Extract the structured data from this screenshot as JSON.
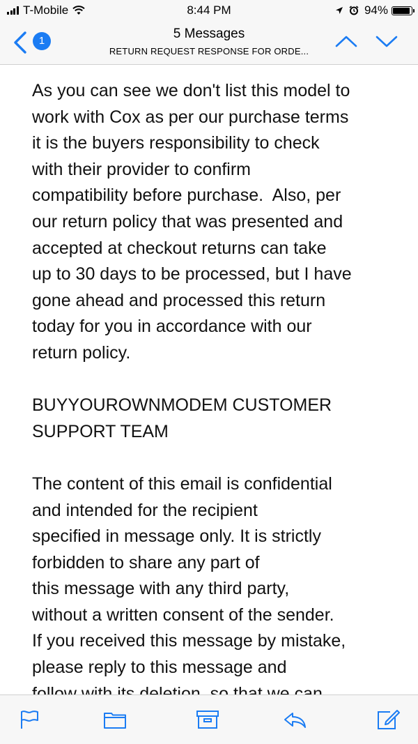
{
  "status_bar": {
    "carrier": "T-Mobile",
    "time": "8:44 PM",
    "battery": "94%",
    "battery_level": 0.94
  },
  "nav": {
    "back_badge_count": "1",
    "title": "5 Messages",
    "subtitle": "RETURN REQUEST RESPONSE FOR ORDE..."
  },
  "message": {
    "paragraph1_lines": [
      "As you can see we don't list this model to",
      "work with Cox as per our purchase terms",
      "it is the buyers responsibility to check",
      "with their provider to confirm",
      "compatibility before purchase.  Also, per",
      "our return policy that was presented and",
      "accepted at checkout returns can take",
      "up to 30 days to be processed, but I have",
      "gone ahead and processed this return",
      "today for you in accordance with our",
      "return policy."
    ],
    "signature_lines": [
      "BUYYOUROWNMODEM CUSTOMER",
      "SUPPORT TEAM"
    ],
    "disclaimer_lines": [
      "The content of this email is confidential",
      "and intended for the recipient",
      "specified in message only. It is strictly",
      "forbidden to share any part of",
      "this message with any third party,",
      "without a written consent of the sender.",
      "If you received this message by mistake,",
      "please reply to this message and",
      "follow with its deletion, so that we can"
    ]
  },
  "toolbar": {
    "icons": [
      "flag-icon",
      "folder-icon",
      "archive-icon",
      "reply-icon",
      "compose-icon"
    ]
  },
  "colors": {
    "accent": "#1b7cf3",
    "bar_background": "#f7f7f7"
  }
}
